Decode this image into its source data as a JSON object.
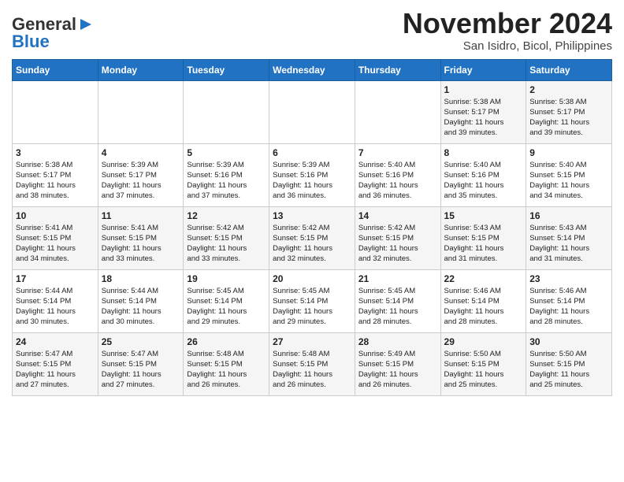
{
  "header": {
    "logo_general": "General",
    "logo_blue": "Blue",
    "month_title": "November 2024",
    "location": "San Isidro, Bicol, Philippines"
  },
  "days_of_week": [
    "Sunday",
    "Monday",
    "Tuesday",
    "Wednesday",
    "Thursday",
    "Friday",
    "Saturday"
  ],
  "weeks": [
    [
      {
        "day": "",
        "info": ""
      },
      {
        "day": "",
        "info": ""
      },
      {
        "day": "",
        "info": ""
      },
      {
        "day": "",
        "info": ""
      },
      {
        "day": "",
        "info": ""
      },
      {
        "day": "1",
        "info": "Sunrise: 5:38 AM\nSunset: 5:17 PM\nDaylight: 11 hours\nand 39 minutes."
      },
      {
        "day": "2",
        "info": "Sunrise: 5:38 AM\nSunset: 5:17 PM\nDaylight: 11 hours\nand 39 minutes."
      }
    ],
    [
      {
        "day": "3",
        "info": "Sunrise: 5:38 AM\nSunset: 5:17 PM\nDaylight: 11 hours\nand 38 minutes."
      },
      {
        "day": "4",
        "info": "Sunrise: 5:39 AM\nSunset: 5:17 PM\nDaylight: 11 hours\nand 37 minutes."
      },
      {
        "day": "5",
        "info": "Sunrise: 5:39 AM\nSunset: 5:16 PM\nDaylight: 11 hours\nand 37 minutes."
      },
      {
        "day": "6",
        "info": "Sunrise: 5:39 AM\nSunset: 5:16 PM\nDaylight: 11 hours\nand 36 minutes."
      },
      {
        "day": "7",
        "info": "Sunrise: 5:40 AM\nSunset: 5:16 PM\nDaylight: 11 hours\nand 36 minutes."
      },
      {
        "day": "8",
        "info": "Sunrise: 5:40 AM\nSunset: 5:16 PM\nDaylight: 11 hours\nand 35 minutes."
      },
      {
        "day": "9",
        "info": "Sunrise: 5:40 AM\nSunset: 5:15 PM\nDaylight: 11 hours\nand 34 minutes."
      }
    ],
    [
      {
        "day": "10",
        "info": "Sunrise: 5:41 AM\nSunset: 5:15 PM\nDaylight: 11 hours\nand 34 minutes."
      },
      {
        "day": "11",
        "info": "Sunrise: 5:41 AM\nSunset: 5:15 PM\nDaylight: 11 hours\nand 33 minutes."
      },
      {
        "day": "12",
        "info": "Sunrise: 5:42 AM\nSunset: 5:15 PM\nDaylight: 11 hours\nand 33 minutes."
      },
      {
        "day": "13",
        "info": "Sunrise: 5:42 AM\nSunset: 5:15 PM\nDaylight: 11 hours\nand 32 minutes."
      },
      {
        "day": "14",
        "info": "Sunrise: 5:42 AM\nSunset: 5:15 PM\nDaylight: 11 hours\nand 32 minutes."
      },
      {
        "day": "15",
        "info": "Sunrise: 5:43 AM\nSunset: 5:15 PM\nDaylight: 11 hours\nand 31 minutes."
      },
      {
        "day": "16",
        "info": "Sunrise: 5:43 AM\nSunset: 5:14 PM\nDaylight: 11 hours\nand 31 minutes."
      }
    ],
    [
      {
        "day": "17",
        "info": "Sunrise: 5:44 AM\nSunset: 5:14 PM\nDaylight: 11 hours\nand 30 minutes."
      },
      {
        "day": "18",
        "info": "Sunrise: 5:44 AM\nSunset: 5:14 PM\nDaylight: 11 hours\nand 30 minutes."
      },
      {
        "day": "19",
        "info": "Sunrise: 5:45 AM\nSunset: 5:14 PM\nDaylight: 11 hours\nand 29 minutes."
      },
      {
        "day": "20",
        "info": "Sunrise: 5:45 AM\nSunset: 5:14 PM\nDaylight: 11 hours\nand 29 minutes."
      },
      {
        "day": "21",
        "info": "Sunrise: 5:45 AM\nSunset: 5:14 PM\nDaylight: 11 hours\nand 28 minutes."
      },
      {
        "day": "22",
        "info": "Sunrise: 5:46 AM\nSunset: 5:14 PM\nDaylight: 11 hours\nand 28 minutes."
      },
      {
        "day": "23",
        "info": "Sunrise: 5:46 AM\nSunset: 5:14 PM\nDaylight: 11 hours\nand 28 minutes."
      }
    ],
    [
      {
        "day": "24",
        "info": "Sunrise: 5:47 AM\nSunset: 5:15 PM\nDaylight: 11 hours\nand 27 minutes."
      },
      {
        "day": "25",
        "info": "Sunrise: 5:47 AM\nSunset: 5:15 PM\nDaylight: 11 hours\nand 27 minutes."
      },
      {
        "day": "26",
        "info": "Sunrise: 5:48 AM\nSunset: 5:15 PM\nDaylight: 11 hours\nand 26 minutes."
      },
      {
        "day": "27",
        "info": "Sunrise: 5:48 AM\nSunset: 5:15 PM\nDaylight: 11 hours\nand 26 minutes."
      },
      {
        "day": "28",
        "info": "Sunrise: 5:49 AM\nSunset: 5:15 PM\nDaylight: 11 hours\nand 26 minutes."
      },
      {
        "day": "29",
        "info": "Sunrise: 5:50 AM\nSunset: 5:15 PM\nDaylight: 11 hours\nand 25 minutes."
      },
      {
        "day": "30",
        "info": "Sunrise: 5:50 AM\nSunset: 5:15 PM\nDaylight: 11 hours\nand 25 minutes."
      }
    ]
  ]
}
